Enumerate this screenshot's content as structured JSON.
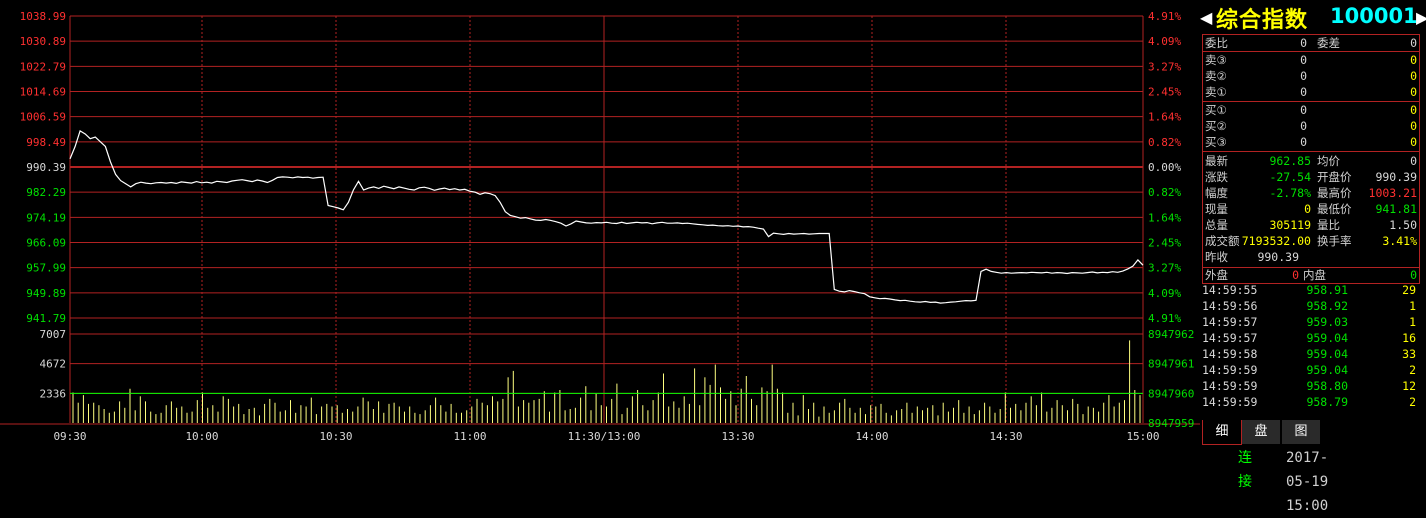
{
  "header": {
    "left_arrow": "◀",
    "name": "综合指数",
    "code": "100001",
    "right_arrow": "▶"
  },
  "orderbook": {
    "weibi_label": "委比",
    "weibi_value": "0",
    "weicha_label": "委差",
    "weicha_value": "0",
    "sells": [
      {
        "label": "卖③",
        "price": "0",
        "vol": "0"
      },
      {
        "label": "卖②",
        "price": "0",
        "vol": "0"
      },
      {
        "label": "卖①",
        "price": "0",
        "vol": "0"
      }
    ],
    "buys": [
      {
        "label": "买①",
        "price": "0",
        "vol": "0"
      },
      {
        "label": "买②",
        "price": "0",
        "vol": "0"
      },
      {
        "label": "买③",
        "price": "0",
        "vol": "0"
      }
    ]
  },
  "quote": {
    "latest_label": "最新",
    "latest": "962.85",
    "avg_label": "均价",
    "avg": "0",
    "change_label": "涨跌",
    "change": "-27.54",
    "open_label": "开盘价",
    "open": "990.39",
    "pct_label": "幅度",
    "pct": "-2.78%",
    "high_label": "最高价",
    "high": "1003.21",
    "cur_vol_label": "现量",
    "cur_vol": "0",
    "low_label": "最低价",
    "low": "941.81",
    "total_vol_label": "总量",
    "total_vol": "305119",
    "vol_ratio_label": "量比",
    "vol_ratio": "1.50",
    "turnover_label": "成交额",
    "turnover": "7193532.00",
    "turnover_rate_label": "换手率",
    "turnover_rate": "3.41%",
    "prev_close_label": "昨收",
    "prev_close": "990.39",
    "outer_label": "外盘",
    "outer": "0",
    "inner_label": "内盘",
    "inner": "0"
  },
  "ticks": [
    {
      "time": "14:59:55",
      "price": "958.91",
      "vol": "29"
    },
    {
      "time": "14:59:56",
      "price": "958.92",
      "vol": "1"
    },
    {
      "time": "14:59:57",
      "price": "959.03",
      "vol": "1"
    },
    {
      "time": "14:59:57",
      "price": "959.04",
      "vol": "16"
    },
    {
      "time": "14:59:58",
      "price": "959.04",
      "vol": "33"
    },
    {
      "time": "14:59:59",
      "price": "959.04",
      "vol": "2"
    },
    {
      "time": "14:59:59",
      "price": "958.80",
      "vol": "12"
    },
    {
      "time": "14:59:59",
      "price": "958.79",
      "vol": "2"
    }
  ],
  "tabs": [
    {
      "label": "细",
      "active": true
    },
    {
      "label": "盘",
      "active": false
    },
    {
      "label": "图",
      "active": false
    }
  ],
  "status": {
    "connection": "连接",
    "datetime": "2017-05-19 15:00"
  },
  "colors": {
    "up": "#ff3030",
    "down": "#00e000",
    "flat": "#d8d8d8",
    "grid": "#b22222",
    "volume": "#ffff80",
    "avg_line": "#00ff00"
  },
  "chart_data": {
    "type": "line",
    "price_axis_left": [
      "1038.99",
      "1030.89",
      "1022.79",
      "1014.69",
      "1006.59",
      "998.49",
      "990.39",
      "982.29",
      "974.19",
      "966.09",
      "957.99",
      "949.89",
      "941.79"
    ],
    "price_axis_right": [
      "4.91%",
      "4.09%",
      "3.27%",
      "2.45%",
      "1.64%",
      "0.82%",
      "0.00%",
      "0.82%",
      "1.64%",
      "2.45%",
      "3.27%",
      "4.09%",
      "4.91%"
    ],
    "volume_axis_left": [
      "7007",
      "4672",
      "2336"
    ],
    "volume_axis_right": [
      "8947962",
      "8947961",
      "8947960",
      "8947959"
    ],
    "x_labels": [
      "09:30",
      "10:00",
      "10:30",
      "11:00",
      "11:30/13:00",
      "13:30",
      "14:00",
      "14:30",
      "15:00"
    ],
    "prev_close": 990.39,
    "ylim": [
      941.79,
      1038.99
    ],
    "volume_ylim": [
      0,
      7007
    ],
    "volume_avg": 2336,
    "price_series": [
      [
        0,
        993
      ],
      [
        1,
        997
      ],
      [
        2,
        1002
      ],
      [
        3,
        1001
      ],
      [
        4,
        999.5
      ],
      [
        5,
        1000
      ],
      [
        6,
        998.5
      ],
      [
        7,
        997
      ],
      [
        8,
        992
      ],
      [
        9,
        988
      ],
      [
        10,
        986
      ],
      [
        11,
        985
      ],
      [
        12,
        984
      ],
      [
        13,
        985
      ],
      [
        14,
        985.5
      ],
      [
        15,
        985.2
      ],
      [
        16,
        985
      ],
      [
        17,
        985.3
      ],
      [
        18,
        985.4
      ],
      [
        19,
        985.2
      ],
      [
        20,
        985.4
      ],
      [
        21,
        985.1
      ],
      [
        22,
        985.6
      ],
      [
        23,
        985.4
      ],
      [
        24,
        985.2
      ],
      [
        25,
        985.7
      ],
      [
        26,
        985.3
      ],
      [
        27,
        985.5
      ],
      [
        28,
        985.2
      ],
      [
        29,
        985.8
      ],
      [
        30,
        985.6
      ],
      [
        31,
        985.4
      ],
      [
        32,
        985.9
      ],
      [
        33,
        986.1
      ],
      [
        34,
        986.3
      ],
      [
        35,
        986
      ],
      [
        36,
        985.7
      ],
      [
        37,
        986.2
      ],
      [
        38,
        985.9
      ],
      [
        39,
        985.4
      ],
      [
        40,
        986.1
      ],
      [
        41,
        987
      ],
      [
        42,
        987.2
      ],
      [
        43,
        987.1
      ],
      [
        44,
        986.9
      ],
      [
        45,
        987.2
      ],
      [
        46,
        987
      ],
      [
        47,
        987.1
      ],
      [
        48,
        986.8
      ],
      [
        49,
        987
      ],
      [
        50,
        987.1
      ],
      [
        51,
        978
      ],
      [
        52,
        977.6
      ],
      [
        53,
        977.2
      ],
      [
        54,
        976.6
      ],
      [
        55,
        979
      ],
      [
        56,
        983
      ],
      [
        57,
        985.8
      ],
      [
        58,
        983
      ],
      [
        59,
        983.6
      ],
      [
        60,
        984
      ],
      [
        61,
        983.5
      ],
      [
        62,
        984.2
      ],
      [
        63,
        983.8
      ],
      [
        64,
        983.4
      ],
      [
        65,
        984
      ],
      [
        66,
        983.6
      ],
      [
        67,
        983.2
      ],
      [
        68,
        983
      ],
      [
        69,
        983.7
      ],
      [
        70,
        983.9
      ],
      [
        71,
        983.5
      ],
      [
        72,
        982.9
      ],
      [
        73,
        983.3
      ],
      [
        74,
        983.6
      ],
      [
        75,
        983.1
      ],
      [
        76,
        983.4
      ],
      [
        77,
        983
      ],
      [
        78,
        983.2
      ],
      [
        79,
        982.6
      ],
      [
        80,
        982.3
      ],
      [
        81,
        981.6
      ],
      [
        82,
        982.1
      ],
      [
        83,
        981.8
      ],
      [
        84,
        981.2
      ],
      [
        85,
        979
      ],
      [
        86,
        976
      ],
      [
        87,
        974.8
      ],
      [
        88,
        974.4
      ],
      [
        89,
        973.9
      ],
      [
        90,
        974.1
      ],
      [
        91,
        973.7
      ],
      [
        92,
        973.3
      ],
      [
        93,
        973.2
      ],
      [
        94,
        973.5
      ],
      [
        95,
        973.2
      ],
      [
        96,
        972.8
      ],
      [
        97,
        972.3
      ],
      [
        98,
        971.4
      ],
      [
        99,
        972.1
      ],
      [
        100,
        973
      ],
      [
        101,
        972.7
      ],
      [
        102,
        972.4
      ],
      [
        103,
        972.3
      ],
      [
        104,
        972.5
      ],
      [
        105,
        972.4
      ],
      [
        106,
        972.6
      ],
      [
        107,
        972.3
      ],
      [
        108,
        972.2
      ],
      [
        109,
        972.6
      ],
      [
        110,
        972.2
      ],
      [
        111,
        972.4
      ],
      [
        112,
        972.6
      ],
      [
        113,
        972.4
      ],
      [
        114,
        972.5
      ],
      [
        115,
        972.1
      ],
      [
        116,
        972.4
      ],
      [
        117,
        972.6
      ],
      [
        118,
        972.3
      ],
      [
        119,
        972.3
      ],
      [
        120,
        972.4
      ],
      [
        121,
        972.2
      ],
      [
        122,
        972.3
      ],
      [
        123,
        972.1
      ],
      [
        124,
        971.9
      ],
      [
        125,
        971.8
      ],
      [
        126,
        971.6
      ],
      [
        127,
        971.7
      ],
      [
        128,
        971.5
      ],
      [
        129,
        971.4
      ],
      [
        130,
        971.5
      ],
      [
        131,
        971.3
      ],
      [
        132,
        971.4
      ],
      [
        133,
        971.1
      ],
      [
        134,
        971.2
      ],
      [
        135,
        971
      ],
      [
        136,
        970.7
      ],
      [
        137,
        970.4
      ],
      [
        138,
        968
      ],
      [
        139,
        969.1
      ],
      [
        140,
        968.9
      ],
      [
        141,
        968.7
      ],
      [
        142,
        969
      ],
      [
        143,
        968.8
      ],
      [
        144,
        968.9
      ],
      [
        145,
        969
      ],
      [
        146,
        968.8
      ],
      [
        147,
        968.9
      ],
      [
        148,
        969
      ],
      [
        149,
        969
      ],
      [
        150,
        969
      ],
      [
        151,
        951
      ],
      [
        152,
        950.4
      ],
      [
        153,
        950.2
      ],
      [
        154,
        950.6
      ],
      [
        155,
        950.3
      ],
      [
        156,
        949.9
      ],
      [
        157,
        949.6
      ],
      [
        158,
        948.6
      ],
      [
        159,
        948.3
      ],
      [
        160,
        948
      ],
      [
        161,
        948.1
      ],
      [
        162,
        947.9
      ],
      [
        163,
        947.6
      ],
      [
        164,
        947.4
      ],
      [
        165,
        947.5
      ],
      [
        166,
        947.2
      ],
      [
        167,
        947
      ],
      [
        168,
        946.9
      ],
      [
        169,
        947.1
      ],
      [
        170,
        946.8
      ],
      [
        171,
        946.9
      ],
      [
        172,
        946.6
      ],
      [
        173,
        946.7
      ],
      [
        174,
        946.9
      ],
      [
        175,
        947
      ],
      [
        176,
        947.2
      ],
      [
        177,
        947.4
      ],
      [
        178,
        947.3
      ],
      [
        179,
        947.5
      ],
      [
        180,
        956.8
      ],
      [
        181,
        957.5
      ],
      [
        182,
        956.8
      ],
      [
        183,
        956.5
      ],
      [
        184,
        956.2
      ],
      [
        185,
        956.4
      ],
      [
        186,
        956.2
      ],
      [
        187,
        956.3
      ],
      [
        188,
        956.4
      ],
      [
        189,
        956.3
      ],
      [
        190,
        956.5
      ],
      [
        191,
        956.4
      ],
      [
        192,
        956.3
      ],
      [
        193,
        956.5
      ],
      [
        194,
        956.2
      ],
      [
        195,
        956.4
      ],
      [
        196,
        956.3
      ],
      [
        197,
        956.1
      ],
      [
        198,
        956.4
      ],
      [
        199,
        956.3
      ],
      [
        200,
        956.2
      ],
      [
        201,
        956.4
      ],
      [
        202,
        956.6
      ],
      [
        203,
        956.3
      ],
      [
        204,
        956.5
      ],
      [
        205,
        956.4
      ],
      [
        206,
        956.7
      ],
      [
        207,
        956.5
      ],
      [
        208,
        956.9
      ],
      [
        209,
        957.6
      ],
      [
        210,
        958.5
      ],
      [
        211,
        960.5
      ],
      [
        212,
        958.8
      ]
    ],
    "volume_series": [
      2400,
      1600,
      2200,
      1500,
      1600,
      1400,
      1100,
      800,
      900,
      1700,
      1200,
      2700,
      1000,
      2100,
      1700,
      900,
      700,
      800,
      1400,
      1700,
      1200,
      1300,
      800,
      900,
      1800,
      2400,
      1200,
      1400,
      900,
      2100,
      1900,
      1300,
      1500,
      700,
      1100,
      1200,
      600,
      1500,
      1900,
      1600,
      900,
      1000,
      1800,
      800,
      1400,
      1300,
      2000,
      700,
      1300,
      1500,
      1300,
      1400,
      800,
      1100,
      900,
      1300,
      2000,
      1700,
      1100,
      1700,
      800,
      1500,
      1600,
      1300,
      900,
      1300,
      800,
      700,
      1000,
      1400,
      2000,
      1400,
      900,
      1500,
      800,
      800,
      1000,
      1300,
      1900,
      1600,
      1400,
      2100,
      1700,
      1900,
      3600,
      4100,
      1300,
      1800,
      1600,
      1800,
      1900,
      2500,
      900,
      2400,
      2600,
      1000,
      1100,
      1200,
      2000,
      2900,
      1000,
      2300,
      1400,
      1300,
      1900,
      3100,
      700,
      1200,
      2100,
      2600,
      1400,
      1000,
      1800,
      2400,
      3900,
      1300,
      1700,
      1200,
      2100,
      1500,
      4300,
      1400,
      3600,
      3000,
      4600,
      2800,
      1900,
      2500,
      1400,
      2700,
      3700,
      1900,
      1400,
      2800,
      2500,
      4600,
      2700,
      2400,
      800,
      1600,
      600,
      2200,
      1100,
      1600,
      500,
      1300,
      800,
      1000,
      1600,
      1900,
      1200,
      800,
      1200,
      700,
      1400,
      1300,
      1500,
      800,
      600,
      1000,
      1100,
      1600,
      800,
      1300,
      1000,
      1200,
      1400,
      600,
      1600,
      900,
      1200,
      1800,
      800,
      1300,
      700,
      1000,
      1600,
      1300,
      800,
      1100,
      2400,
      1200,
      1500,
      1000,
      1600,
      2100,
      1400,
      2400,
      900,
      1200,
      1800,
      1400,
      1000,
      1900,
      1500,
      700,
      1300,
      1200,
      900,
      1600,
      2200,
      1300,
      1600,
      1800,
      6500,
      2600,
      2200
    ]
  }
}
